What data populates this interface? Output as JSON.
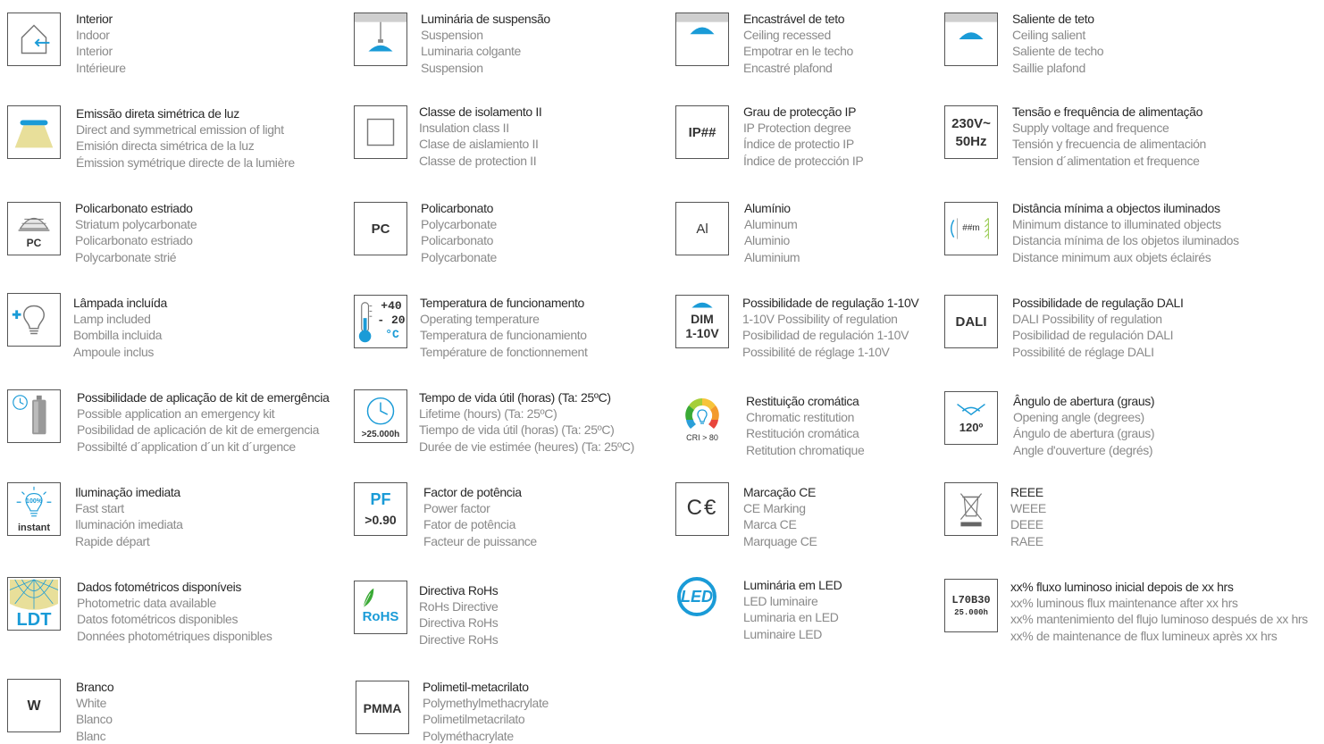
{
  "items": {
    "interior": {
      "label": [
        "Interior",
        "Indoor",
        "Interior",
        "Intérieure"
      ]
    },
    "suspension": {
      "label": [
        "Luminária de suspensão",
        "Suspension",
        "Luminaria colgante",
        "Suspension"
      ]
    },
    "ceiling_recessed": {
      "label": [
        "Encastrável de teto",
        "Ceiling recessed",
        "Empotrar en le techo",
        "Encastré plafond"
      ]
    },
    "ceiling_salient": {
      "label": [
        "Saliente de teto",
        "Ceiling salient",
        "Saliente de techo",
        "Saillie plafond"
      ]
    },
    "direct_emission": {
      "label": [
        "Emissão direta simétrica de luz",
        "Direct and symmetrical emission of light",
        "Emisión directa simétrica de la luz",
        "Émission symétrique directe de la lumière"
      ]
    },
    "class_ii": {
      "label": [
        "Classe de isolamento II",
        "Insulation class II",
        "Clase de aislamiento II",
        "Classe de protection II"
      ]
    },
    "ip_degree": {
      "label": [
        "Grau de protecção IP",
        "IP Protection degree",
        "Índice de protectio IP",
        "Índice de protección IP"
      ],
      "icon_text": "IP##"
    },
    "voltage": {
      "label": [
        "Tensão e frequência de alimentação",
        "Supply voltage and frequence",
        "Tensión y frecuencia de alimentación",
        "Tension d´alimentation et frequence"
      ],
      "icon_text": [
        "230V~",
        "50Hz"
      ]
    },
    "striatum_pc": {
      "label": [
        "Policarbonato estriado",
        "Striatum polycarbonate",
        "Policarbonato estriado",
        "Polycarbonate strié"
      ],
      "icon_text": "PC"
    },
    "polycarbonate": {
      "label": [
        "Policarbonato",
        "Polycarbonate",
        "Policarbonato",
        "Polycarbonate"
      ],
      "icon_text": "PC"
    },
    "aluminum": {
      "label": [
        "Alumínio",
        "Aluminum",
        "Aluminio",
        "Aluminium"
      ],
      "icon_text": "Al"
    },
    "min_distance": {
      "label": [
        "Distância mínima a objectos iluminados",
        "Minimum distance to illuminated objects",
        "Distancia mínima de los objetos iluminados",
        "Distance minimum aux objets éclairés"
      ],
      "icon_text": "##m"
    },
    "lamp_included": {
      "label": [
        "Lâmpada incluída",
        "Lamp included",
        "Bombilla incluida",
        "Ampoule inclus"
      ]
    },
    "operating_temp": {
      "label": [
        "Temperatura de funcionamento",
        "Operating temperature",
        "Temperatura de funcionamiento",
        "Température de fonctionnement"
      ],
      "icon_text": [
        "+40",
        "- 20",
        "°C"
      ]
    },
    "dim_1_10v": {
      "label": [
        "Possibilidade de regulação 1-10V",
        "1-10V Possibility of regulation",
        "Posibilidad de regulación 1-10V",
        "Possibilité de réglage 1-10V"
      ],
      "icon_text": [
        "DIM",
        "1-10V"
      ]
    },
    "dali": {
      "label": [
        "Possibilidade de regulação DALI",
        "DALI Possibility of regulation",
        "Posibilidad de regulación DALI",
        "Possibilité de réglage DALI"
      ],
      "icon_text": "DALI"
    },
    "emergency_kit": {
      "label": [
        "Possibilidade de aplicação de kit de emergência",
        "Possible application an emergency kit",
        "Posibilidad de aplicación de kit de emergencia",
        "Possibilté d´application d´un kit d´urgence"
      ]
    },
    "lifetime": {
      "label": [
        "Tempo de vida útil (horas) (Ta: 25ºC)",
        "Lifetime (hours) (Ta: 25ºC)",
        "Tiempo de vida útil (horas) (Ta: 25ºC)",
        "Durée de vie estimée (heures) (Ta: 25ºC)"
      ],
      "icon_text": ">25.000h"
    },
    "chromatic": {
      "label": [
        "Restituição cromática",
        "Chromatic restitution",
        "Restitución cromática",
        "Retitution chromatique"
      ],
      "icon_text": "CRI > 80"
    },
    "opening_angle": {
      "label": [
        "Ângulo de abertura (graus)",
        "Opening angle (degrees)",
        "Ángulo de abertura (graus)",
        "Angle d'ouverture (degrés)"
      ],
      "icon_text": "120º"
    },
    "fast_start": {
      "label": [
        "Iluminação imediata",
        "Fast start",
        "Iluminación imediata",
        "Rapide départ"
      ],
      "icon_text": [
        "100%",
        "instant"
      ]
    },
    "power_factor": {
      "label": [
        "Factor de potência",
        "Power factor",
        "Fator de potência",
        "Facteur de puissance"
      ],
      "icon_text": [
        "PF",
        ">0.90"
      ]
    },
    "ce_marking": {
      "label": [
        "Marcação CE",
        "CE Marking",
        "Marca CE",
        "Marquage CE"
      ],
      "icon_text": "C€"
    },
    "weee": {
      "label": [
        "REEE",
        "WEEE",
        "DEEE",
        "RAEE"
      ]
    },
    "photometric": {
      "label": [
        "Dados fotométricos disponíveis",
        "Photometric data available",
        "Datos fotométricos disponibles",
        "Données photométriques disponibles"
      ],
      "icon_text": "LDT"
    },
    "rohs": {
      "label": [
        "Directiva RoHs",
        "RoHs Directive",
        "Directiva RoHs",
        "Directive RoHs"
      ],
      "icon_text": "RoHS"
    },
    "led_luminaire": {
      "label": [
        "Luminária em LED",
        "LED luminaire",
        "Luminaria en LED",
        "Luminaire LED"
      ],
      "icon_text": "LED"
    },
    "lumen_maintenance": {
      "label": [
        "xx% fluxo luminoso inicial depois de xx hrs",
        "xx% luminous flux maintenance after xx hrs",
        "xx% mantenimiento del flujo luminoso después de xx hrs",
        "xx% de maintenance de flux lumineux après xx hrs"
      ],
      "icon_text": [
        "L70B30",
        "25.000h"
      ]
    },
    "white": {
      "label": [
        "Branco",
        "White",
        "Blanco",
        "Blanc"
      ],
      "icon_text": "W"
    },
    "pmma": {
      "label": [
        "Polimetil-metacrilato",
        "Polymethylmethacrylate",
        "Polimetilmetacrilato",
        "Polyméthacrylate"
      ],
      "icon_text": "PMMA"
    }
  },
  "colors": {
    "accent": "#1a9bd7",
    "text_primary": "#2a2a2a",
    "text_secondary": "#8a8a8a",
    "yellow": "#e8df9a",
    "green": "#3aaa35"
  }
}
